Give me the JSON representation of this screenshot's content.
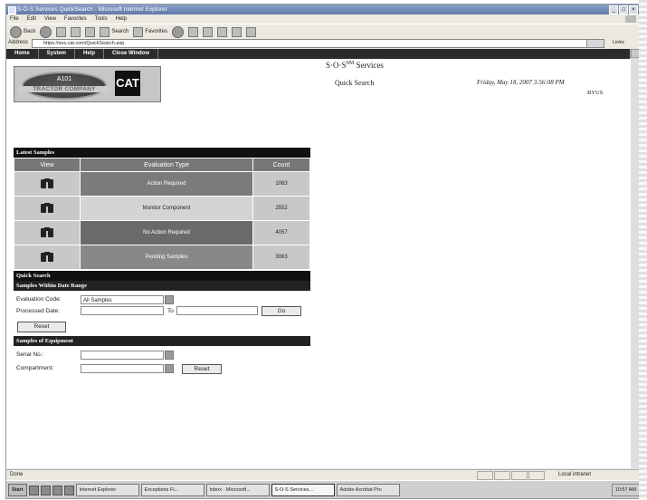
{
  "window": {
    "title": "S-O-S Services QuickSearch - Microsoft Internet Explorer",
    "controls": [
      "_",
      "□",
      "×"
    ]
  },
  "menubar": [
    "File",
    "Edit",
    "View",
    "Favorites",
    "Tools",
    "Help"
  ],
  "toolbar": {
    "back": "Back",
    "search": "Search",
    "favorites": "Favorites"
  },
  "address": {
    "label": "Address",
    "url": "https://sos.cat.com/QuickSearch.asp",
    "go": "Go",
    "links": "Links"
  },
  "app_nav": [
    "Home",
    "System",
    "Help",
    "Close Window"
  ],
  "logo": {
    "line1": "A101",
    "line2": "TRACTOR COMPANY",
    "brand": "CAT"
  },
  "header": {
    "service_name": "S·O·S",
    "service_mark": "SM",
    "service_suffix": " Services",
    "page_name": "Quick Search",
    "date": "Friday, May 18, 2007 3:56:08 PM",
    "user": "BYUS"
  },
  "latest_samples": {
    "title": "Latest Samples",
    "columns": [
      "View",
      "Evaluation Type",
      "Count"
    ],
    "rows": [
      {
        "type": "Action Required",
        "count": "1063",
        "color": "#7b7b7b"
      },
      {
        "type": "Monitor Component",
        "count": "2552",
        "color": "#d4d4d4"
      },
      {
        "type": "No Action Required",
        "count": "4057",
        "color": "#6a6a6a"
      },
      {
        "type": "Pending Samples",
        "count": "3063",
        "color": "#888888"
      }
    ]
  },
  "quick_search": {
    "title": "Quick Search",
    "date_range": {
      "title": "Samples Within Date Range",
      "evaluation_label": "Evaluation Code:",
      "evaluation_value": "All Samples",
      "processed_label": "Processed Date:",
      "to_label": "To",
      "go_label": "Go",
      "reset_label": "Reset"
    },
    "equipment": {
      "title": "Samples of Equipment",
      "serial_label": "Serial No.:",
      "component_label": "Compartment:",
      "reset_label": "Reset"
    }
  },
  "statusbar": {
    "text": "Done",
    "zone": "Local intranet"
  },
  "taskbar": {
    "start": "Start",
    "tasks": [
      "Internet Explorer",
      "Exceptions Fi...",
      "Inbox - Microsoft...",
      "S-O-S Services...",
      "Adobe Acrobat Pro"
    ],
    "active_index": 3,
    "clock": "10:57 AM"
  }
}
